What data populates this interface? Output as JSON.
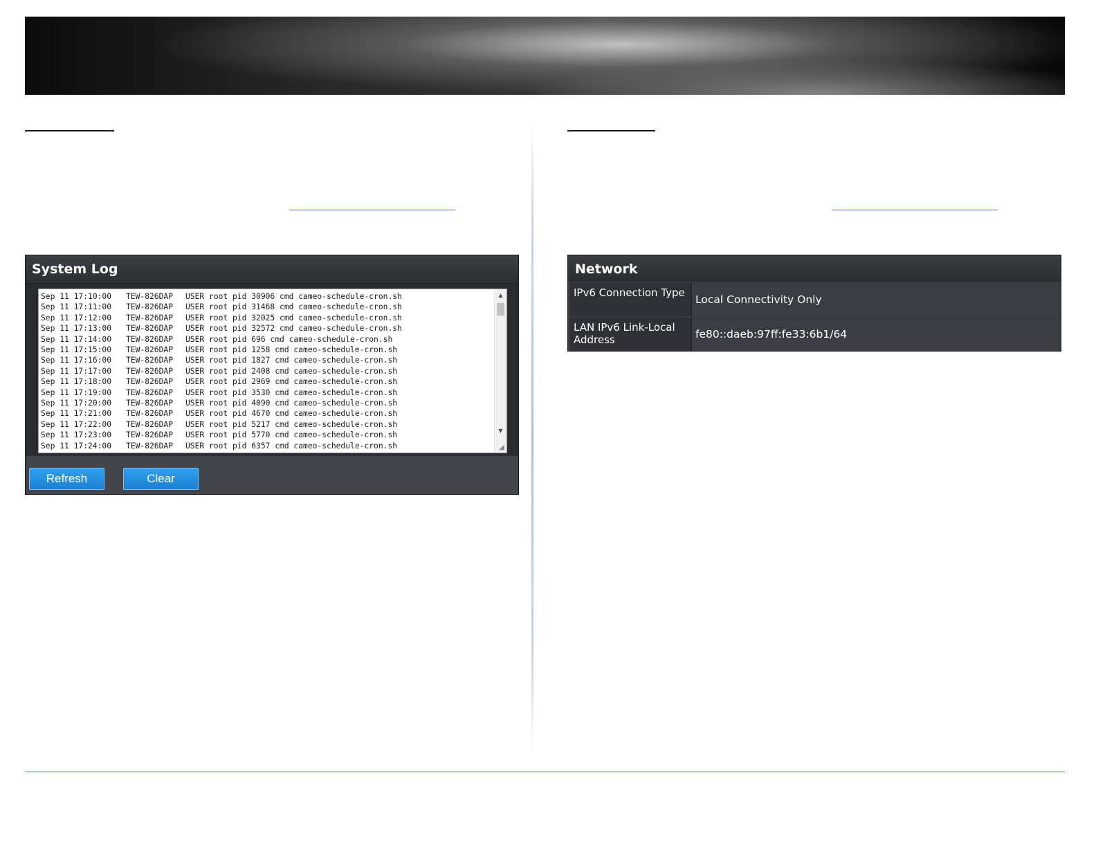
{
  "system_log": {
    "title": "System Log",
    "lines": [
      {
        "date": "Sep 11 17:10:00",
        "host": "TEW-826DAP",
        "user": "USER",
        "msg": "root pid 30906 cmd cameo-schedule-cron.sh"
      },
      {
        "date": "Sep 11 17:11:00",
        "host": "TEW-826DAP",
        "user": "USER",
        "msg": "root pid 31468 cmd cameo-schedule-cron.sh"
      },
      {
        "date": "Sep 11 17:12:00",
        "host": "TEW-826DAP",
        "user": "USER",
        "msg": "root pid 32025 cmd cameo-schedule-cron.sh"
      },
      {
        "date": "Sep 11 17:13:00",
        "host": "TEW-826DAP",
        "user": "USER",
        "msg": "root pid 32572 cmd cameo-schedule-cron.sh"
      },
      {
        "date": "Sep 11 17:14:00",
        "host": "TEW-826DAP",
        "user": "USER",
        "msg": "root pid 696 cmd cameo-schedule-cron.sh"
      },
      {
        "date": "Sep 11 17:15:00",
        "host": "TEW-826DAP",
        "user": "USER",
        "msg": "root pid 1258 cmd cameo-schedule-cron.sh"
      },
      {
        "date": "Sep 11 17:16:00",
        "host": "TEW-826DAP",
        "user": "USER",
        "msg": "root pid 1827 cmd cameo-schedule-cron.sh"
      },
      {
        "date": "Sep 11 17:17:00",
        "host": "TEW-826DAP",
        "user": "USER",
        "msg": "root pid 2408 cmd cameo-schedule-cron.sh"
      },
      {
        "date": "Sep 11 17:18:00",
        "host": "TEW-826DAP",
        "user": "USER",
        "msg": "root pid 2969 cmd cameo-schedule-cron.sh"
      },
      {
        "date": "Sep 11 17:19:00",
        "host": "TEW-826DAP",
        "user": "USER",
        "msg": "root pid 3530 cmd cameo-schedule-cron.sh"
      },
      {
        "date": "Sep 11 17:20:00",
        "host": "TEW-826DAP",
        "user": "USER",
        "msg": "root pid 4090 cmd cameo-schedule-cron.sh"
      },
      {
        "date": "Sep 11 17:21:00",
        "host": "TEW-826DAP",
        "user": "USER",
        "msg": "root pid 4670 cmd cameo-schedule-cron.sh"
      },
      {
        "date": "Sep 11 17:22:00",
        "host": "TEW-826DAP",
        "user": "USER",
        "msg": "root pid 5217 cmd cameo-schedule-cron.sh"
      },
      {
        "date": "Sep 11 17:23:00",
        "host": "TEW-826DAP",
        "user": "USER",
        "msg": "root pid 5770 cmd cameo-schedule-cron.sh"
      },
      {
        "date": "Sep 11 17:24:00",
        "host": "TEW-826DAP",
        "user": "USER",
        "msg": "root pid 6357 cmd cameo-schedule-cron.sh"
      }
    ],
    "buttons": {
      "refresh": "Refresh",
      "clear": "Clear"
    }
  },
  "network": {
    "title": "Network",
    "rows": [
      {
        "label": "IPv6 Connection Type",
        "value": "Local Connectivity Only"
      },
      {
        "label": "LAN IPv6 Link-Local Address",
        "value": "fe80::daeb:97ff:fe33:6b1/64"
      }
    ]
  }
}
